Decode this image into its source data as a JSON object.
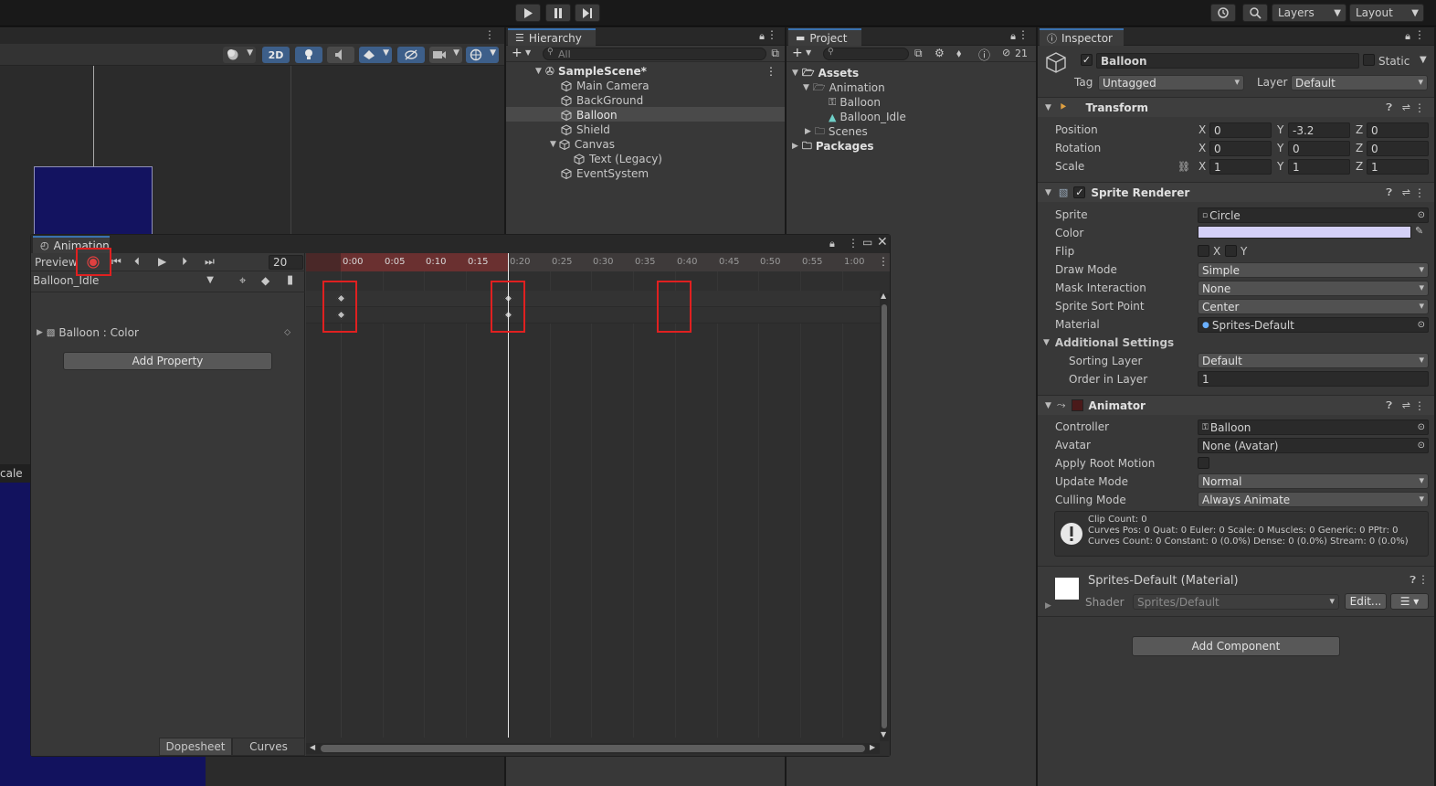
{
  "top_toolbar": {
    "layers_label": "Layers",
    "layout_label": "Layout"
  },
  "scene_view": {
    "mode_2d": "2D",
    "scale_label": "cale"
  },
  "hierarchy": {
    "tab": "Hierarchy",
    "search_placeholder": "All",
    "items": [
      {
        "label": "SampleScene*"
      },
      {
        "label": "Main Camera"
      },
      {
        "label": "BackGround"
      },
      {
        "label": "Balloon"
      },
      {
        "label": "Shield"
      },
      {
        "label": "Canvas"
      },
      {
        "label": "Text (Legacy)"
      },
      {
        "label": "EventSystem"
      }
    ]
  },
  "project": {
    "tab": "Project",
    "hidden_count": "21",
    "items": [
      {
        "label": "Assets"
      },
      {
        "label": "Animation"
      },
      {
        "label": "Balloon"
      },
      {
        "label": "Balloon_Idle"
      },
      {
        "label": "Scenes"
      },
      {
        "label": "Packages"
      }
    ]
  },
  "animation": {
    "tab": "Animation",
    "preview_label": "Preview",
    "frame": "20",
    "clip": "Balloon_Idle",
    "property": "Balloon : Color",
    "add_property": "Add Property",
    "dopesheet": "Dopesheet",
    "curves": "Curves",
    "ticks": [
      "0:00",
      "0:05",
      "0:10",
      "0:15",
      "0:20",
      "0:25",
      "0:30",
      "0:35",
      "0:40",
      "0:45",
      "0:50",
      "0:55",
      "1:00"
    ]
  },
  "inspector": {
    "tab": "Inspector",
    "object_name": "Balloon",
    "static_label": "Static",
    "tag_label": "Tag",
    "tag_value": "Untagged",
    "layer_label": "Layer",
    "layer_value": "Default",
    "transform": {
      "title": "Transform",
      "position_label": "Position",
      "rotation_label": "Rotation",
      "scale_label": "Scale",
      "x": "X",
      "y": "Y",
      "z": "Z",
      "position": [
        "0",
        "-3.2",
        "0"
      ],
      "rotation": [
        "0",
        "0",
        "0"
      ],
      "scale": [
        "1",
        "1",
        "1"
      ]
    },
    "sprite_renderer": {
      "title": "Sprite Renderer",
      "sprite_label": "Sprite",
      "sprite_value": "Circle",
      "color_label": "Color",
      "color_value": "#d4d0f7",
      "flip_label": "Flip",
      "flip_x": "X",
      "flip_y": "Y",
      "draw_mode_label": "Draw Mode",
      "draw_mode_value": "Simple",
      "mask_label": "Mask Interaction",
      "mask_value": "None",
      "sort_point_label": "Sprite Sort Point",
      "sort_point_value": "Center",
      "material_label": "Material",
      "material_value": "Sprites-Default",
      "additional_label": "Additional Settings",
      "sorting_layer_label": "Sorting Layer",
      "sorting_layer_value": "Default",
      "order_label": "Order in Layer",
      "order_value": "1"
    },
    "animator": {
      "title": "Animator",
      "controller_label": "Controller",
      "controller_value": "Balloon",
      "avatar_label": "Avatar",
      "avatar_value": "None (Avatar)",
      "root_motion_label": "Apply Root Motion",
      "update_label": "Update Mode",
      "update_value": "Normal",
      "culling_label": "Culling Mode",
      "culling_value": "Always Animate",
      "info_line1": "Clip Count: 0",
      "info_line2": "Curves Pos: 0 Quat: 0 Euler: 0 Scale: 0 Muscles: 0 Generic: 0 PPtr: 0",
      "info_line3": "Curves Count: 0 Constant: 0 (0.0%) Dense: 0 (0.0%) Stream: 0 (0.0%)"
    },
    "material": {
      "title": "Sprites-Default (Material)",
      "shader_label": "Shader",
      "shader_value": "Sprites/Default",
      "edit_label": "Edit..."
    },
    "add_component": "Add Component"
  }
}
